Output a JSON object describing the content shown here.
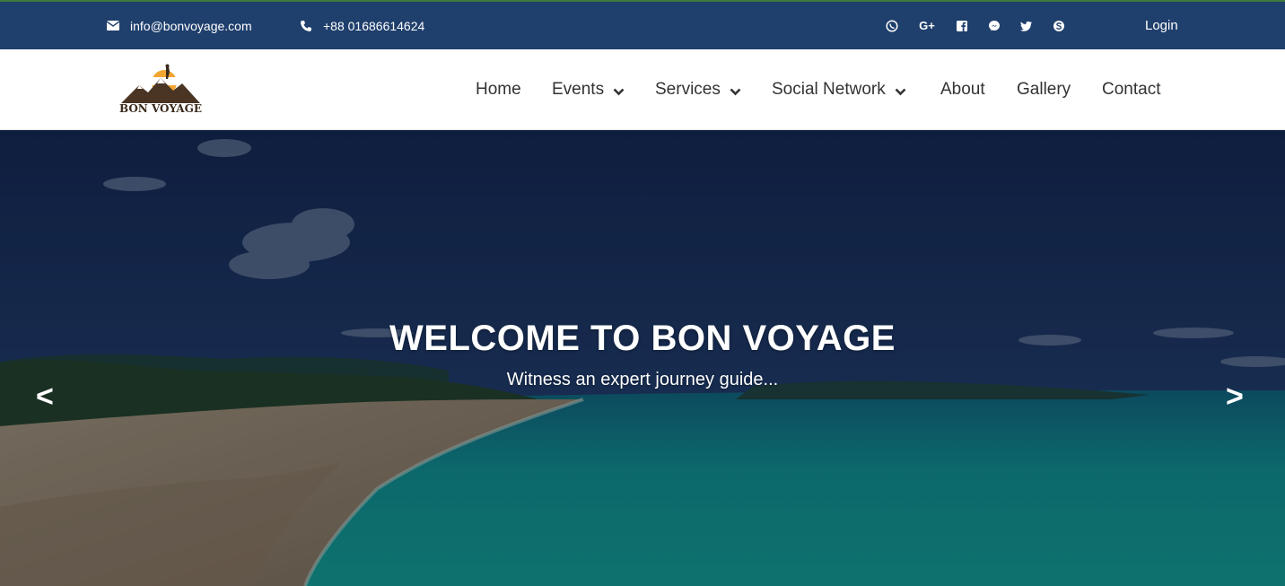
{
  "topbar": {
    "email": "info@bonvoyage.com",
    "phone": "+88 01686614624",
    "social_icons": [
      "viber-icon",
      "google-plus-icon",
      "facebook-icon",
      "messenger-icon",
      "twitter-icon",
      "skype-icon"
    ],
    "google_plus_label": "G+",
    "login_label": "Login"
  },
  "brand": {
    "logo_text": "BON VOYAGE"
  },
  "nav": {
    "home": "Home",
    "events": "Events",
    "services": "Services",
    "social_network": "Social Network",
    "about": "About",
    "gallery": "Gallery",
    "contact": "Contact"
  },
  "hero": {
    "title": "WELCOME TO BON VOYAGE",
    "subtitle": "Witness an expert journey guide...",
    "prev_label": "<",
    "next_label": ">"
  },
  "colors": {
    "topbar_bg": "#1f3f6c",
    "nav_text": "#333333",
    "hero_text": "#ffffff",
    "logo_sun": "#f2a531"
  }
}
